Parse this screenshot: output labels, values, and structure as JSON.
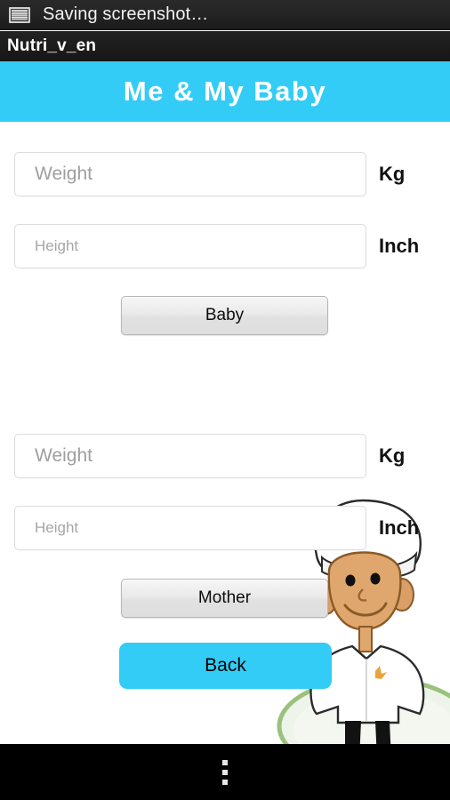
{
  "status_bar": {
    "icon": "screenshot-image-icon",
    "text": "Saving screenshot…"
  },
  "title_bar": {
    "app_name": "Nutri_v_en"
  },
  "banner": {
    "title": "Me & My Baby",
    "background_color": "#33ccf6",
    "text_color": "#ffffff"
  },
  "baby_section": {
    "weight": {
      "placeholder": "Weight",
      "value": "",
      "unit": "Kg"
    },
    "height": {
      "placeholder": "Height",
      "value": "",
      "unit": "Inch"
    },
    "button_label": "Baby"
  },
  "mother_section": {
    "weight": {
      "placeholder": "Weight",
      "value": "",
      "unit": "Kg"
    },
    "height": {
      "placeholder": "Height",
      "value": "",
      "unit": "Inch"
    },
    "button_label": "Mother"
  },
  "back_button": {
    "label": "Back",
    "background_color": "#33ccf6",
    "text_color": "#000000"
  },
  "illustration": {
    "name": "chef-character",
    "description": "cartoon chef with white hat and coat standing on green circle",
    "skin_color": "#d9a06b",
    "coat_color": "#ffffff",
    "ground_color": "#9ac27e"
  },
  "nav_bar": {
    "overflow_menu": "overflow-menu-icon"
  }
}
